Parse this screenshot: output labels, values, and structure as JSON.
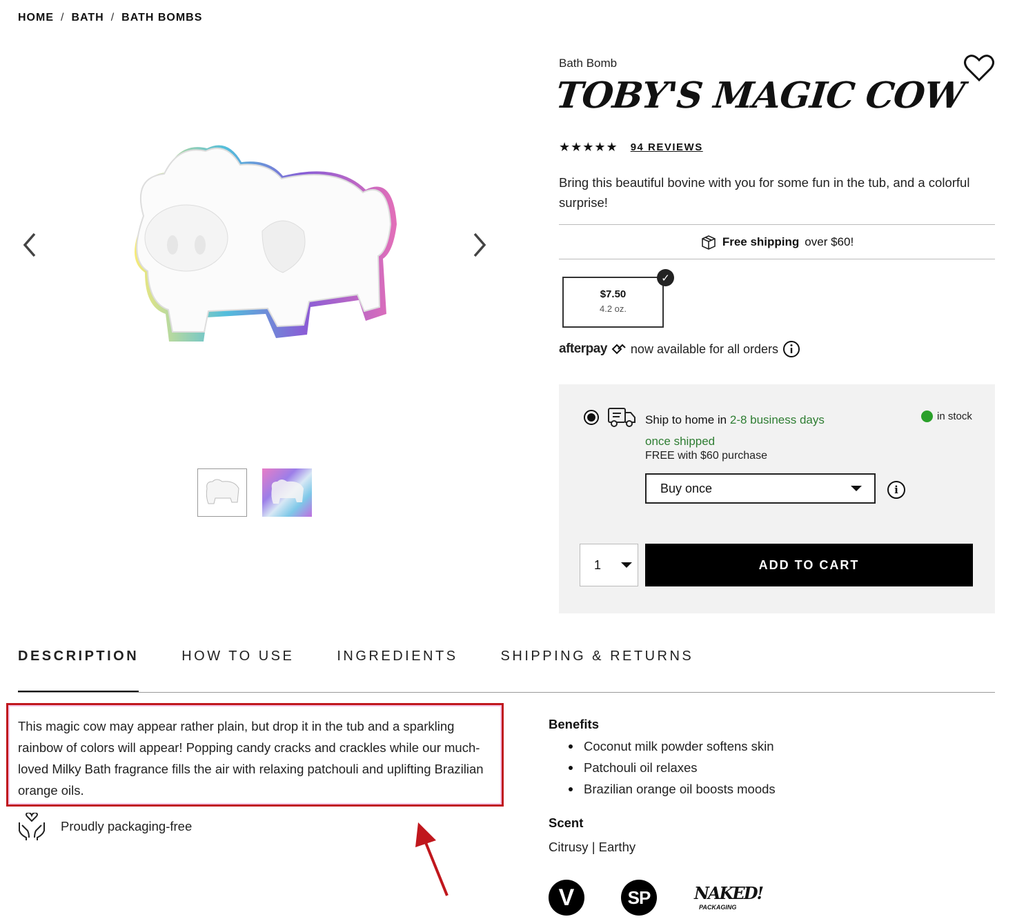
{
  "breadcrumb": {
    "items": [
      "HOME",
      "BATH",
      "BATH BOMBS"
    ],
    "separator": "/"
  },
  "gallery": {
    "prev_icon": "chevron-left-icon",
    "next_icon": "chevron-right-icon",
    "thumbnails": [
      "cow-thumbnail",
      "rainbow-thumbnail"
    ]
  },
  "product": {
    "category": "Bath Bomb",
    "title": "TOBY'S MAGIC COW",
    "stars": "★★★★★",
    "rating_value": 4.5,
    "reviews": "94 REVIEWS",
    "tagline": "Bring this beautiful bovine with you for some fun in the tub, and a colorful surprise!"
  },
  "shipping_bar": {
    "bold": "Free shipping",
    "rest": "over $60!"
  },
  "size": {
    "price": "$7.50",
    "weight": "4.2 oz.",
    "check": "✓"
  },
  "afterpay": {
    "logo": "afterpay",
    "text": "now available for all orders"
  },
  "delivery": {
    "line1_a": "Ship to home in ",
    "line1_b": "2-8 business days",
    "line2": "once shipped",
    "free": "FREE with $60 purchase",
    "stock": "in stock",
    "purchase_option": "Buy once",
    "quantity": "1",
    "add_to_cart": "ADD TO CART",
    "info": "i"
  },
  "tabs": [
    "DESCRIPTION",
    "HOW TO USE",
    "INGREDIENTS",
    "SHIPPING & RETURNS"
  ],
  "description": {
    "text": "This magic cow may appear rather plain, but drop it in the tub and a sparkling rainbow of colors will appear! Popping candy cracks and crackles while our much-loved Milky Bath fragrance fills the air with relaxing patchouli and uplifting Brazilian orange oils.",
    "packaging": "Proudly packaging-free"
  },
  "benefits": {
    "heading": "Benefits",
    "items": [
      "Coconut milk powder softens skin",
      "Patchouli oil relaxes",
      "Brazilian orange oil boosts moods"
    ]
  },
  "scent": {
    "heading": "Scent",
    "value": "Citrusy | Earthy"
  },
  "badges": {
    "v": "V",
    "sp": "SP",
    "naked": "NAKED!",
    "naked_sub": "PACKAGING"
  },
  "colors": {
    "highlight_box": "#c0171d",
    "arrow": "#c0171d",
    "in_stock": "#2aa02a",
    "green_text": "#2e7d32"
  }
}
